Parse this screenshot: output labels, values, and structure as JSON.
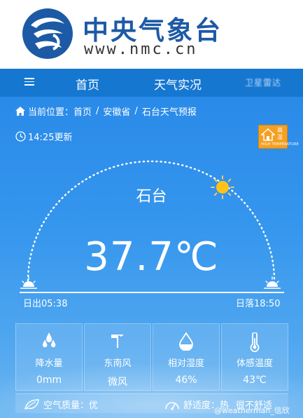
{
  "header": {
    "title": "中央气象台",
    "url": "www.nmc.cn",
    "logo_icon": "nmc-logo-icon"
  },
  "nav": {
    "menu_icon": "hamburger-menu-icon",
    "items": [
      {
        "label": "首页"
      },
      {
        "label": "天气实况"
      }
    ],
    "blurred_label": "卫星雷达"
  },
  "breadcrumb": {
    "prefix": "当前位置：",
    "items": [
      "首页",
      "安徽省",
      "石台天气预报"
    ],
    "separator": "/"
  },
  "update": {
    "label": "14:25更新"
  },
  "warning": {
    "line1": "高",
    "line2": "温",
    "caption": "HIGH TEMPERATURE",
    "color": "#f5a020"
  },
  "weather": {
    "city": "石台",
    "temperature": "37.7℃",
    "sunrise": "日出05:38",
    "sunset": "日落18:50"
  },
  "stats": [
    {
      "icon": "raindrops-icon",
      "label": "降水量",
      "value": "0mm"
    },
    {
      "icon": "wind-vane-icon",
      "label": "东南风",
      "value": "微风"
    },
    {
      "icon": "humidity-drop-icon",
      "label": "相对湿度",
      "value": "46%"
    },
    {
      "icon": "thermometer-icon",
      "label": "体感温度",
      "value": "43℃"
    }
  ],
  "air_quality": {
    "label": "空气质量：优"
  },
  "comfort": {
    "label": "舒适度：热",
    "detail": "很不舒适"
  },
  "watermark": "@weatherman_信欣",
  "colors": {
    "brand_blue": "#1d5aa5",
    "nav_blue": "#1677d1",
    "sky_blue": "#2a8ae8",
    "sun_yellow": "#ffc21a"
  }
}
